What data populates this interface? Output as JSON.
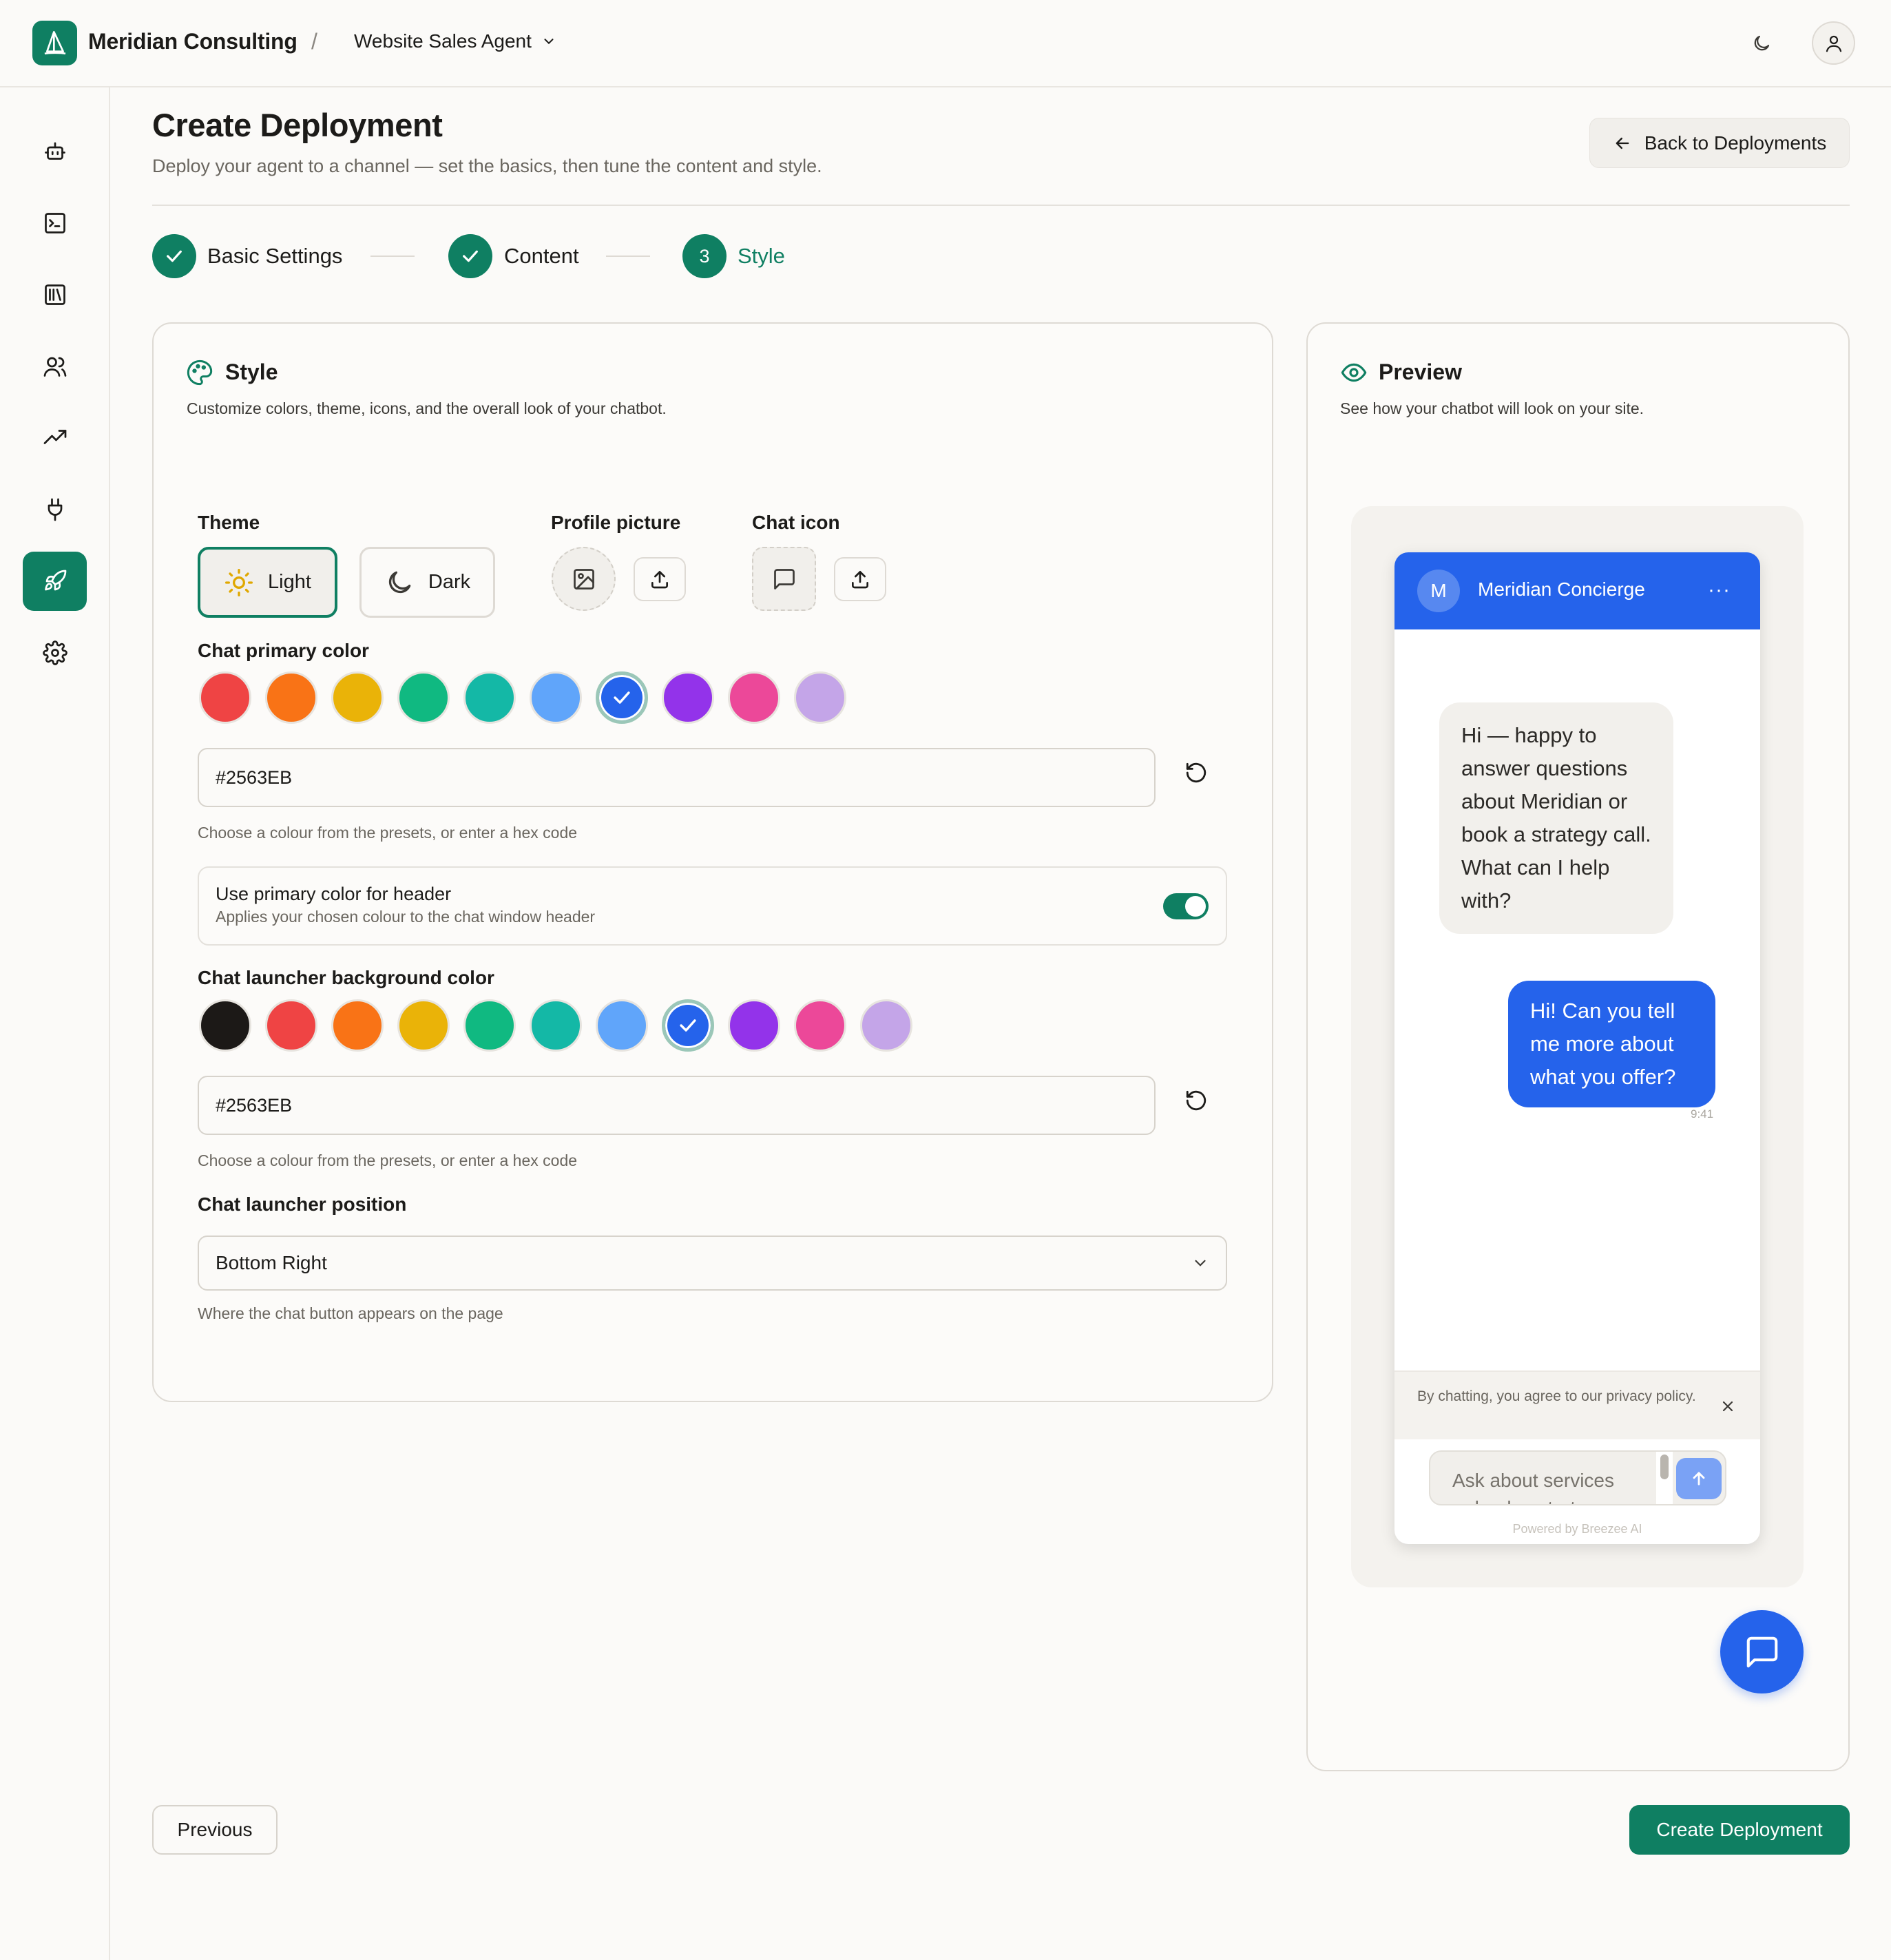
{
  "header": {
    "org_name": "Meridian Consulting",
    "separator": "/",
    "agent_name": "Website Sales Agent"
  },
  "page": {
    "title": "Create Deployment",
    "subtitle": "Deploy your agent to a channel — set the basics, then tune the content and style.",
    "back_label": "Back to Deployments"
  },
  "steps": [
    {
      "label": "Basic Settings",
      "state": "done"
    },
    {
      "label": "Content",
      "state": "done"
    },
    {
      "label": "Style",
      "state": "current",
      "number": "3"
    }
  ],
  "style_card": {
    "title": "Style",
    "subtitle": "Customize colors, theme, icons, and the overall look of your chatbot.",
    "theme_label": "Theme",
    "theme_light": "Light",
    "theme_dark": "Dark",
    "theme_selected": "Light",
    "profile_picture_label": "Profile picture",
    "chat_icon_label": "Chat icon",
    "primary_color_label": "Chat primary color",
    "primary_colors": [
      "#EF4444",
      "#F97316",
      "#EAB308",
      "#10B981",
      "#14B8A6",
      "#60A5FA",
      "#2563EB",
      "#9333EA",
      "#EC4899",
      "#C4A5E8"
    ],
    "primary_selected": "#2563EB",
    "primary_hex_value": "#2563EB",
    "hex_help": "Choose a colour from the presets, or enter a hex code",
    "header_toggle_title": "Use primary color for header",
    "header_toggle_desc": "Applies your chosen colour to the chat window header",
    "header_toggle_on": true,
    "launcher_bg_label": "Chat launcher background color",
    "launcher_colors": [
      "#1C1917",
      "#EF4444",
      "#F97316",
      "#EAB308",
      "#10B981",
      "#14B8A6",
      "#60A5FA",
      "#2563EB",
      "#9333EA",
      "#EC4899",
      "#C4A5E8"
    ],
    "launcher_selected": "#2563EB",
    "launcher_hex_value": "#2563EB",
    "launcher_position_label": "Chat launcher position",
    "launcher_position_value": "Bottom Right",
    "launcher_position_help": "Where the chat button appears on the page"
  },
  "preview_card": {
    "title": "Preview",
    "subtitle": "See how your chatbot will look on your site.",
    "chat": {
      "avatar_letter": "M",
      "bot_name": "Meridian Concierge",
      "more": "···",
      "bot_message": "Hi — happy to answer questions about Meridian or book a strategy call. What can I help with?",
      "user_message": "Hi! Can you tell me more about what you offer?",
      "time": "9:41",
      "privacy_notice": "By chatting, you agree to our privacy policy.",
      "input_placeholder": "Ask about services or book a strategy call",
      "powered_by": "Powered by Breezee AI"
    }
  },
  "footer": {
    "previous_label": "Previous",
    "create_label": "Create Deployment"
  },
  "colors": {
    "brand": "#0F7F62",
    "chat_primary": "#2563EB"
  },
  "icons": {
    "sidebar": [
      "bot-icon",
      "terminal-icon",
      "library-icon",
      "users-icon",
      "trending-up-icon",
      "plug-icon",
      "rocket-icon",
      "gear-icon"
    ]
  }
}
